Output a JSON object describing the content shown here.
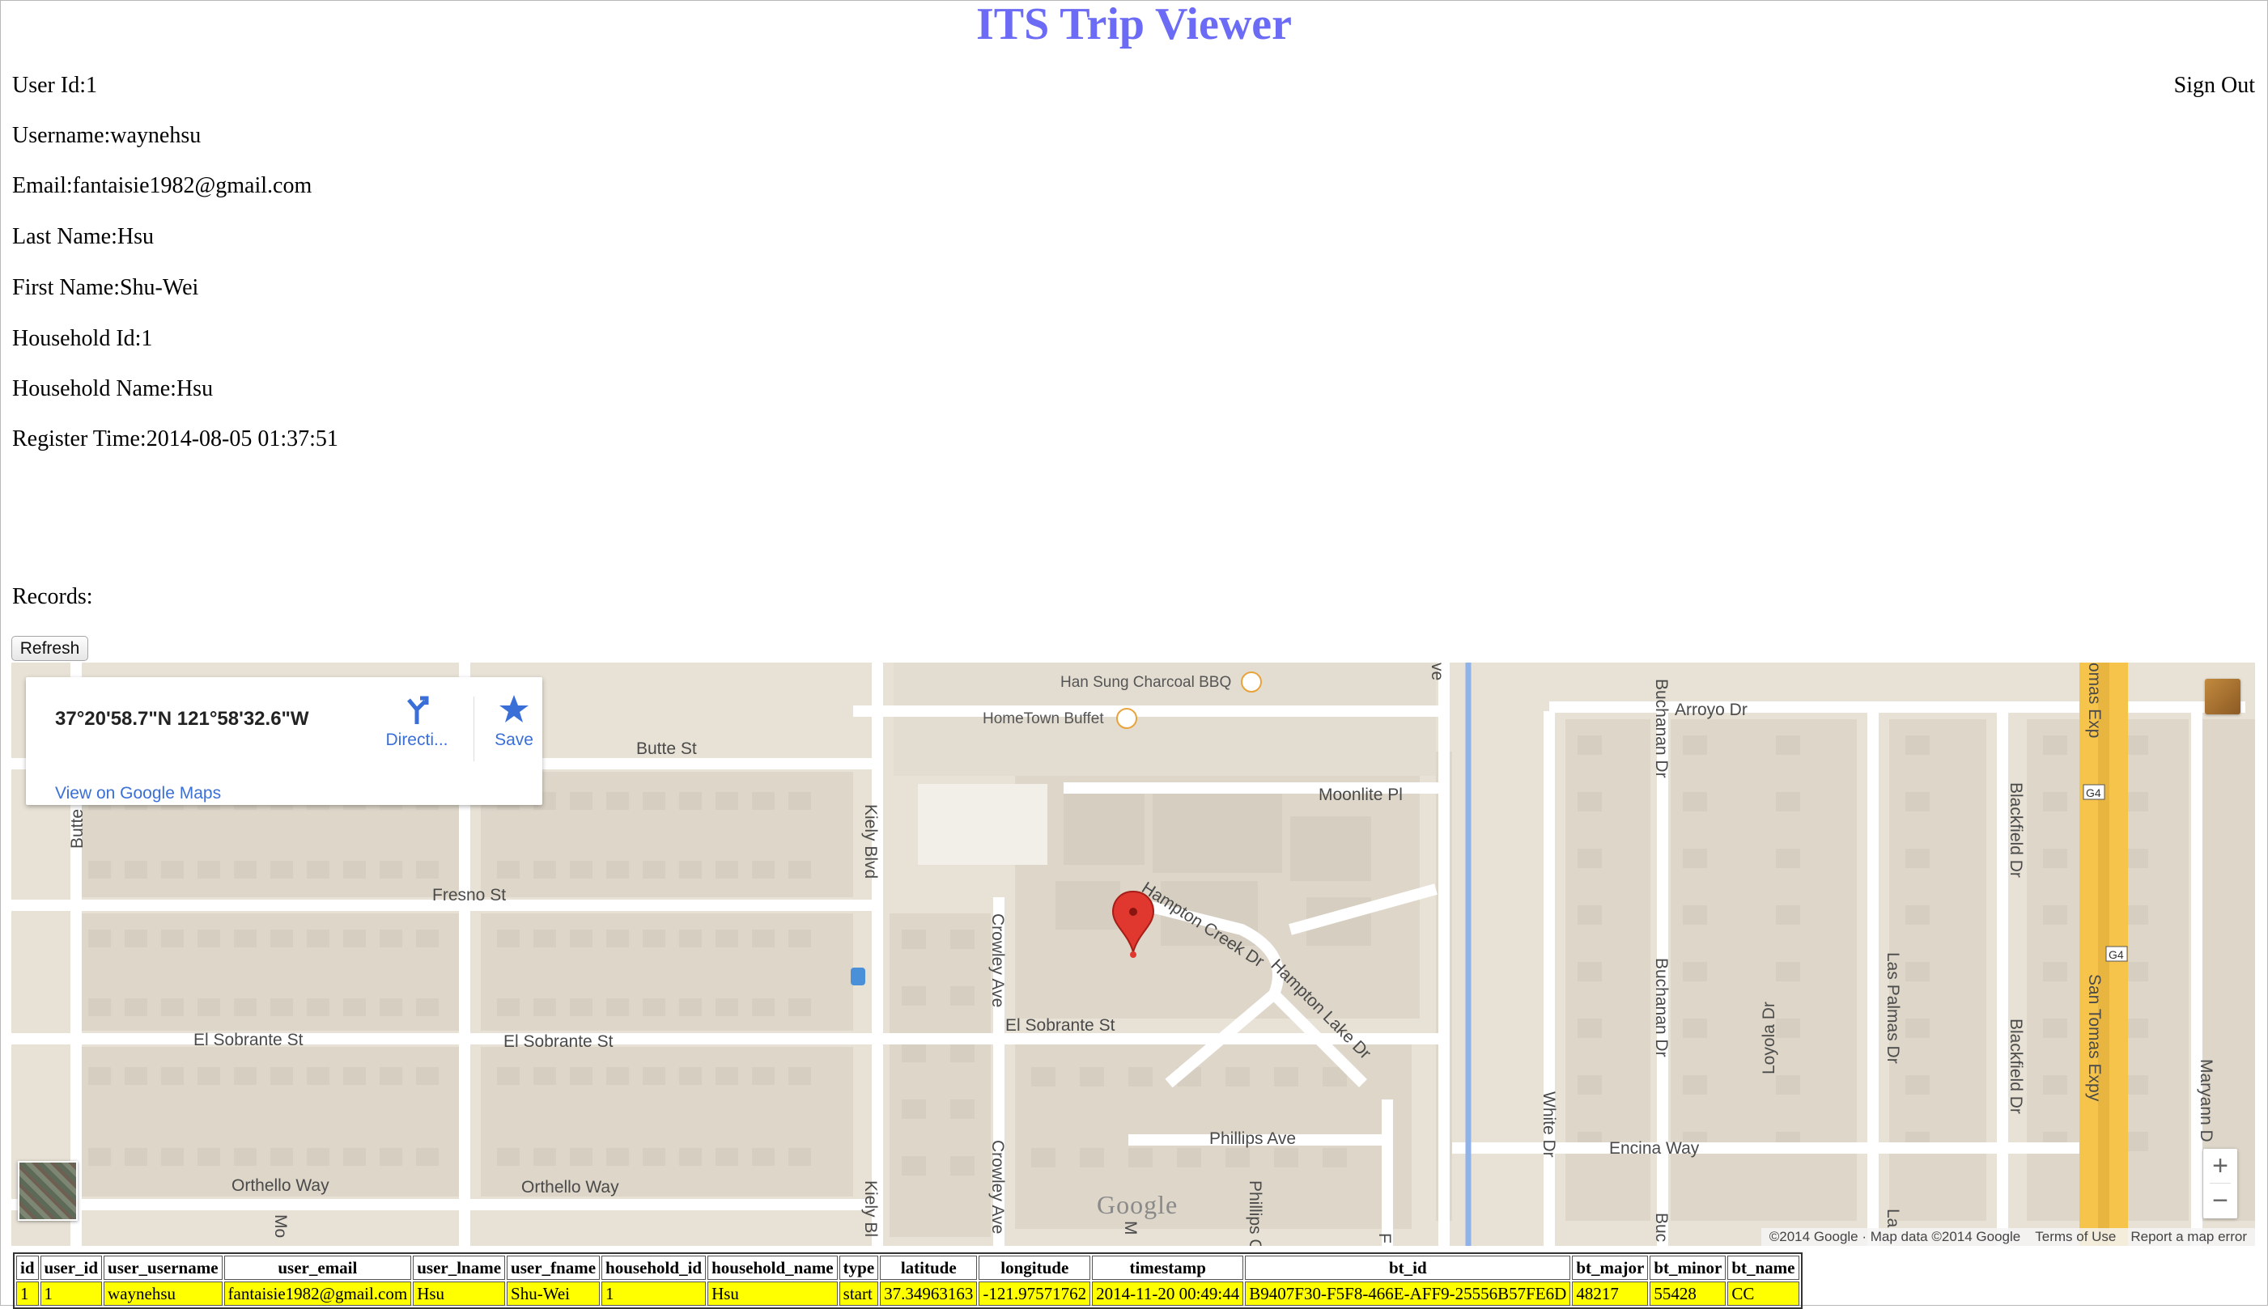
{
  "page": {
    "title": "ITS Trip Viewer",
    "sign_out": "Sign Out"
  },
  "user": {
    "user_id": "User Id:1",
    "username": "Username:waynehsu",
    "email": "Email:fantaisie1982@gmail.com",
    "last_name": "Last Name:Hsu",
    "first_name": "First Name:Shu-Wei",
    "household_id": "Household Id:1",
    "household_name": "Household Name:Hsu",
    "register_time": "Register Time:2014-08-05 01:37:51"
  },
  "records_label": "Records:",
  "refresh_label": "Refresh",
  "map": {
    "info_card": {
      "coords": "37°20'58.7\"N 121°58'32.6\"W",
      "directions": "Directi...",
      "save": "Save",
      "view_link": "View on Google Maps"
    },
    "streets": {
      "butte_st": "Butte St",
      "butte_v": "Butte",
      "fresno_st": "Fresno St",
      "el_sobrante_1": "El Sobrante St",
      "el_sobrante_2": "El Sobrante St",
      "el_sobrante_3": "El Sobrante St",
      "orthello_1": "Orthello Way",
      "orthello_2": "Orthello Way",
      "kiely_1": "Kiely Blvd",
      "kiely_2": "Kiely Bl",
      "crowley_1": "Crowley Ave",
      "crowley_2": "Crowley Ave",
      "mo": "Mo",
      "m": "M",
      "moonlite": "Moonlite Pl",
      "hampton_creek": "Hampton Creek Dr",
      "hampton_lake": "Hampton Lake Dr",
      "phillips_ave": "Phillips Ave",
      "phillips_v": "Phillips C",
      "f": "F",
      "ave": "ve",
      "white_dr": "White Dr",
      "buchanan_1": "Buchanan Dr",
      "buchanan_2": "Buchanan Dr",
      "buchanan_3": "Buc",
      "arroyo": "Arroyo Dr",
      "encina": "Encina Way",
      "loyola": "Loyola Dr",
      "las_palmas": "Las Palmas Dr",
      "la": "La",
      "blackfield_1": "Blackfield Dr",
      "blackfield_2": "Blackfield Dr",
      "san_tomas_1": "omas Exp",
      "san_tomas_2": "San Tomas Expy",
      "g4": "G4",
      "maryann": "Maryann D"
    },
    "pois": {
      "han_sung": "Han Sung Charcoal BBQ",
      "hometown": "HomeTown Buffet"
    },
    "google_logo": "Google",
    "footer": {
      "copyright": "©2014 Google · Map data ©2014 Google",
      "terms": "Terms of Use",
      "report": "Report a map error"
    },
    "zoom_in": "+",
    "zoom_out": "−"
  },
  "table": {
    "headers": [
      "id",
      "user_id",
      "user_username",
      "user_email",
      "user_lname",
      "user_fname",
      "household_id",
      "household_name",
      "type",
      "latitude",
      "longitude",
      "timestamp",
      "bt_id",
      "bt_major",
      "bt_minor",
      "bt_name"
    ],
    "rows": [
      [
        "1",
        "1",
        "waynehsu",
        "fantaisie1982@gmail.com",
        "Hsu",
        "Shu-Wei",
        "1",
        "Hsu",
        "start",
        "37.34963163",
        "-121.97571762",
        "2014-11-20 00:49:44",
        "B9407F30-F5F8-466E-AFF9-25556B57FE6D",
        "48217",
        "55428",
        "CC"
      ]
    ]
  },
  "colors": {
    "title": "#6b6bf5",
    "row_highlight": "#ffff00",
    "marker": "#e0372e",
    "link": "#3a6fd8"
  }
}
